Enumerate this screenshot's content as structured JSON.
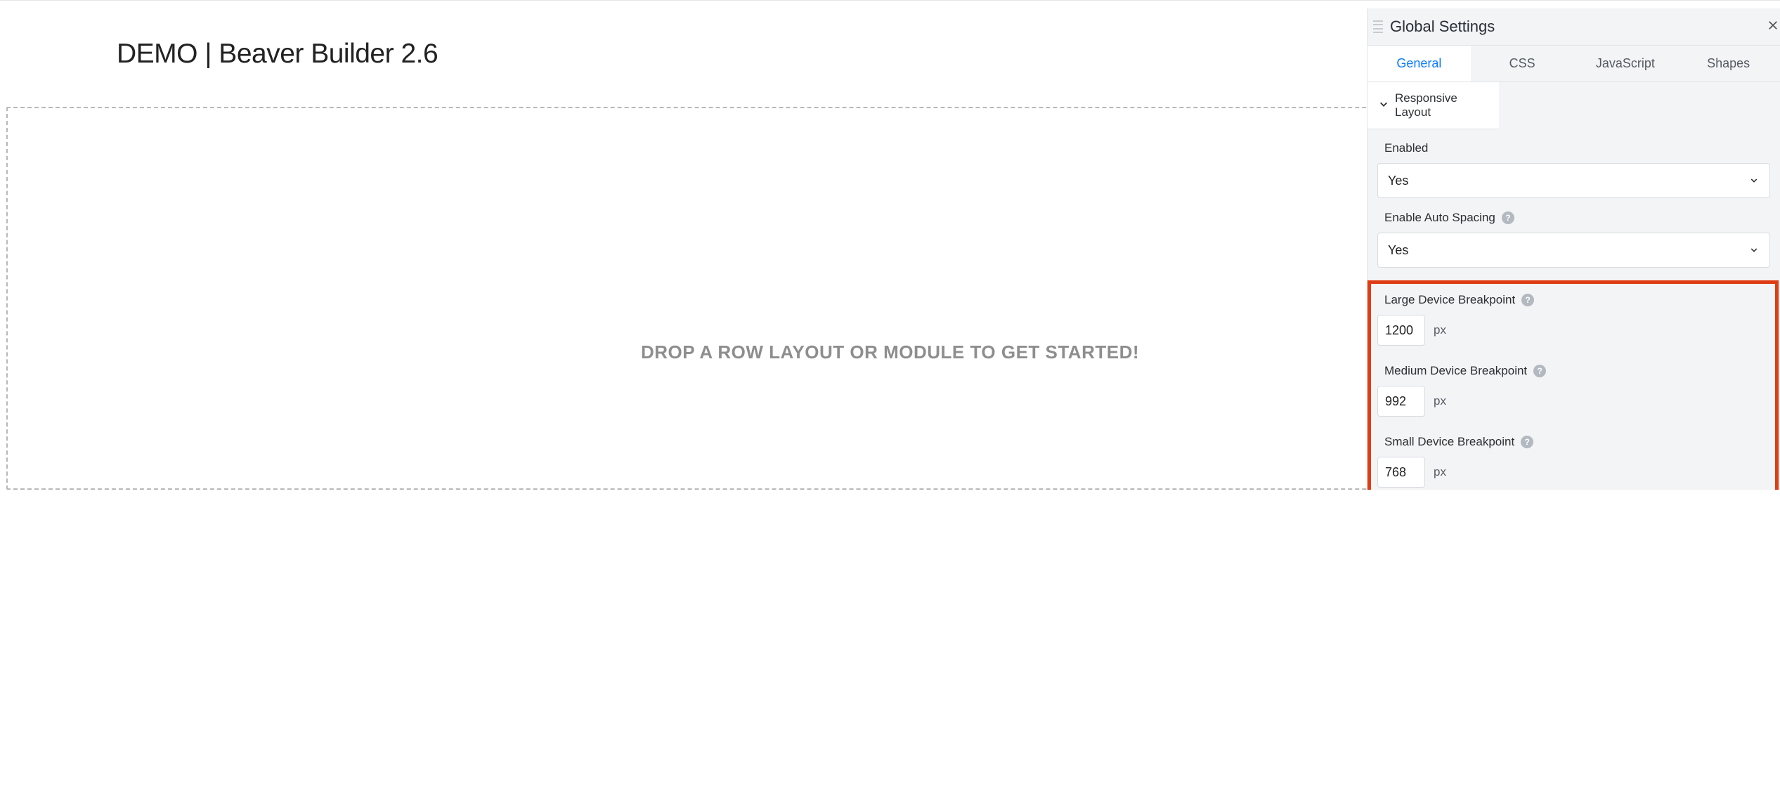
{
  "page": {
    "title": "DEMO | Beaver Builder 2.6",
    "dropzone_text": "DROP A ROW LAYOUT OR MODULE TO GET STARTED!"
  },
  "panel": {
    "title": "Global Settings",
    "tabs": [
      {
        "label": "General",
        "active": true
      },
      {
        "label": "CSS",
        "active": false
      },
      {
        "label": "JavaScript",
        "active": false
      },
      {
        "label": "Shapes",
        "active": false
      }
    ],
    "section_title": "Responsive Layout",
    "fields": {
      "enabled": {
        "label": "Enabled",
        "value": "Yes"
      },
      "auto_spacing": {
        "label": "Enable Auto Spacing",
        "value": "Yes"
      },
      "bp_large": {
        "label": "Large Device Breakpoint",
        "value": "1200",
        "unit": "px"
      },
      "bp_medium": {
        "label": "Medium Device Breakpoint",
        "value": "992",
        "unit": "px"
      },
      "bp_small": {
        "label": "Small Device Breakpoint",
        "value": "768",
        "unit": "px"
      }
    }
  }
}
